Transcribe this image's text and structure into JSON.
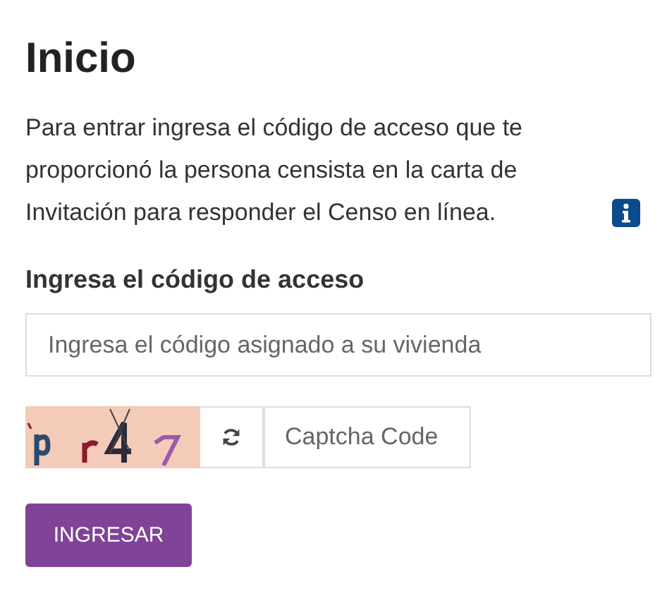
{
  "title": "Inicio",
  "intro": "Para entrar ingresa el código de acceso que te proporcionó la persona censista en la carta de Invitación para responder el Censo en línea.",
  "access_code": {
    "label": "Ingresa el código de acceso",
    "placeholder": "Ingresa el código asignado a su vivienda"
  },
  "captcha": {
    "placeholder": "Captcha Code"
  },
  "submit": "INGRESAR"
}
